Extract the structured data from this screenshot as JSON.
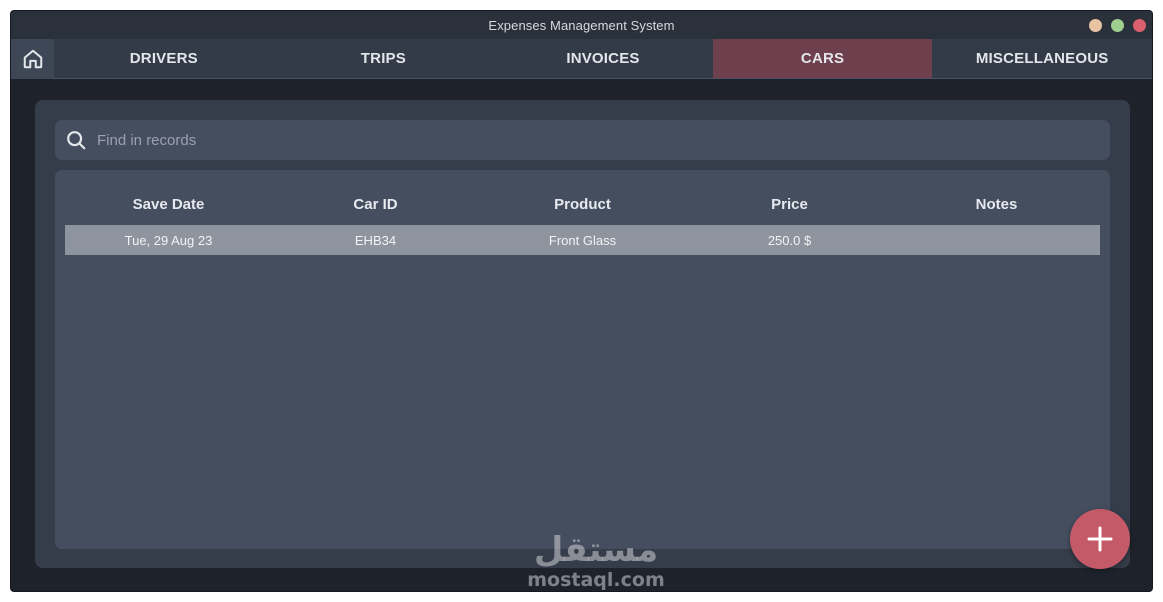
{
  "window": {
    "title": "Expenses Management System",
    "controls": [
      {
        "name": "minimize",
        "color": "#e8c4a3"
      },
      {
        "name": "maximize",
        "color": "#9fcf8f"
      },
      {
        "name": "close",
        "color": "#d9606c"
      }
    ]
  },
  "nav": {
    "home_icon": "home-icon",
    "tabs": [
      {
        "label": "DRIVERS",
        "active": false
      },
      {
        "label": "TRIPS",
        "active": false
      },
      {
        "label": "INVOICES",
        "active": false
      },
      {
        "label": "CARS",
        "active": true
      },
      {
        "label": "MISCELLANEOUS",
        "active": false
      }
    ]
  },
  "search": {
    "placeholder": "Find in records",
    "value": "",
    "icon": "search-icon"
  },
  "table": {
    "columns": [
      "Save Date",
      "Car ID",
      "Product",
      "Price",
      "Notes"
    ],
    "rows": [
      [
        "Tue, 29 Aug 23",
        "EHB34",
        "Front Glass",
        "250.0 $",
        ""
      ]
    ]
  },
  "fab": {
    "icon": "plus-icon",
    "color": "#c45a67"
  },
  "watermark": {
    "arabic": "مستقل",
    "latin": "mostaql.com"
  },
  "colors": {
    "accent_tab": "#6e3f4c",
    "selected_row": "#8f959e",
    "panel": "#353d4a",
    "card": "#454e5f"
  }
}
